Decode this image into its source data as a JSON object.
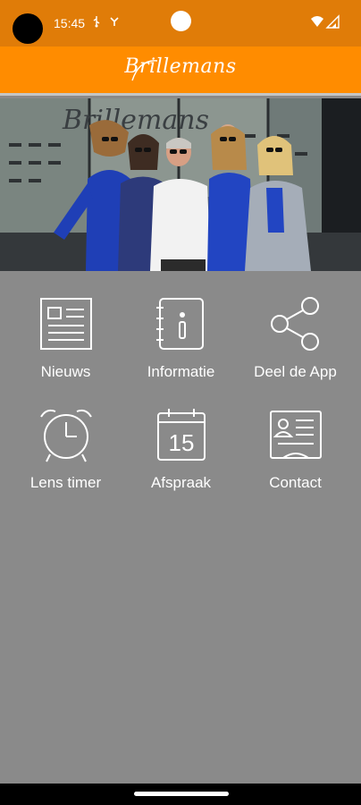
{
  "status_bar": {
    "time": "15:45",
    "left_icons": [
      "usb-icon",
      "network-icon"
    ],
    "right_icons": [
      "wifi-icon",
      "signal-icon"
    ]
  },
  "header": {
    "brand": "Brillemans",
    "color": "#ff8c00"
  },
  "hero": {
    "image": "shop-storefront-photo"
  },
  "menu": [
    {
      "label": "Nieuws",
      "icon": "newspaper-icon"
    },
    {
      "label": "Informatie",
      "icon": "info-book-icon"
    },
    {
      "label": "Deel de App",
      "icon": "share-icon"
    },
    {
      "label": "Lens timer",
      "icon": "alarm-clock-icon"
    },
    {
      "label": "Afspraak",
      "icon": "calendar-icon",
      "calendar_day": "15"
    },
    {
      "label": "Contact",
      "icon": "contact-card-icon"
    }
  ]
}
